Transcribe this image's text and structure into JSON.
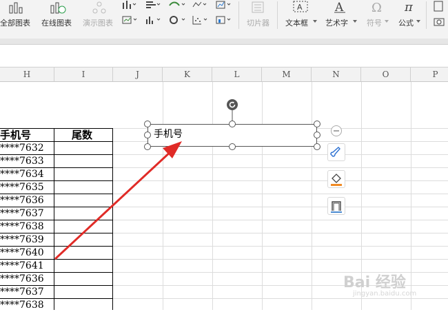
{
  "ribbon": {
    "all_charts": "全部图表",
    "online_charts": "在线图表",
    "demo_charts": "演示图表",
    "slicer": "切片器",
    "textbox": "文本框",
    "wordart": "艺术字",
    "symbol": "符号",
    "formula": "公式"
  },
  "columns": [
    "H",
    "I",
    "J",
    "K",
    "L",
    "M",
    "N",
    "O",
    "P"
  ],
  "table": {
    "header_phone": "手机号",
    "header_tail": "尾数",
    "phones": [
      "****7632",
      "****7633",
      "****7634",
      "****7635",
      "****7636",
      "****7637",
      "****7638",
      "****7639",
      "****7640",
      "****7641",
      "****7636",
      "****7637",
      "****7638"
    ]
  },
  "textbox": {
    "text": "手机号"
  },
  "watermark": {
    "main": "Bai 经验",
    "sub": "jingyan.baidu.com"
  }
}
